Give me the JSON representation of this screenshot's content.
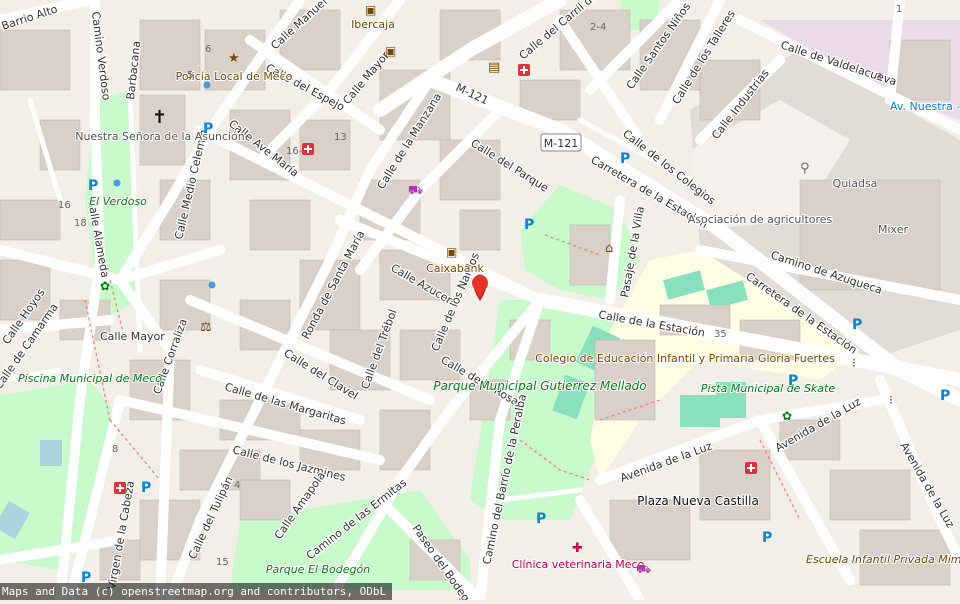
{
  "map": {
    "attribution": "Maps and Data (c) openstreetmap.org and contributors, ODbL",
    "streets": [
      "Barrio Alto",
      "Camino Verdoso",
      "Barbacana",
      "Calle del Espejo",
      "Calle Ave María",
      "Calle Mayor",
      "Calle de la Manzana",
      "Calle del Parque",
      "Calle Medio Celemín",
      "Calle Alameda",
      "Calle de los Colegios",
      "Calle Santos Niños",
      "Calle de los Talleres",
      "Calle Industrias",
      "Calle de Valdelacueva",
      "Carretera de la Estación",
      "Camino de Azuqueca",
      "Calle Azucena",
      "Calle de los Nardos",
      "Ronda de Santa María",
      "Calle de la Rosa",
      "Calle del Trébol",
      "Calle del Clavel",
      "Calle de las Margaritas",
      "Calle de los Jazmines",
      "Calle Corraliza",
      "Calle Amapola",
      "Camino de las Ermitas",
      "Paseo del Bodegón",
      "Camino del Barrio de la Peralba",
      "Calle de la Estación",
      "Pasaje de la Villa",
      "Avenida de la Luz",
      "Calle del Tulipán",
      "Virgen de la Cabeza",
      "Calle de Camarma",
      "Calle Hoyos",
      "Calle del Carril de las Eras",
      "Calle Manuel",
      "Calle de los Nardos"
    ],
    "road_ref": "M-121",
    "places": [
      "Nuestra Señora de la Asunción",
      "Policía Local de Meco",
      "Ibercaja",
      "Caixabank",
      "El Verdoso",
      "Piscina Municipal de Meco",
      "Parque Municipal Gutierrez Mellado",
      "Colegio de Educación Infantil y Primaria Gloria Fuertes",
      "Pista Municipal de Skate",
      "Plaza Nueva Castilla",
      "Clínica veterinaria Meco",
      "Parque El Bodegón",
      "Asociación de agricultores",
      "Quiadsa",
      "Mixer",
      "Escuela Infantil Privada Mimos",
      "Av. Nuestra - Valde"
    ],
    "house_numbers": [
      "6",
      "5",
      "13",
      "16-14",
      "16",
      "18",
      "2-4",
      "3",
      "1",
      "35",
      "4",
      "15",
      "8"
    ],
    "colors": {
      "background": "#f2efe9",
      "building": "#d9d0c9",
      "park": "#c8facc",
      "school": "#ffffe5",
      "industrial": "#ebdbe8",
      "road": "#ffffff",
      "marker": "#e8302a",
      "parking": "#0a84d0"
    },
    "marker_icon": "location-pin-icon"
  }
}
